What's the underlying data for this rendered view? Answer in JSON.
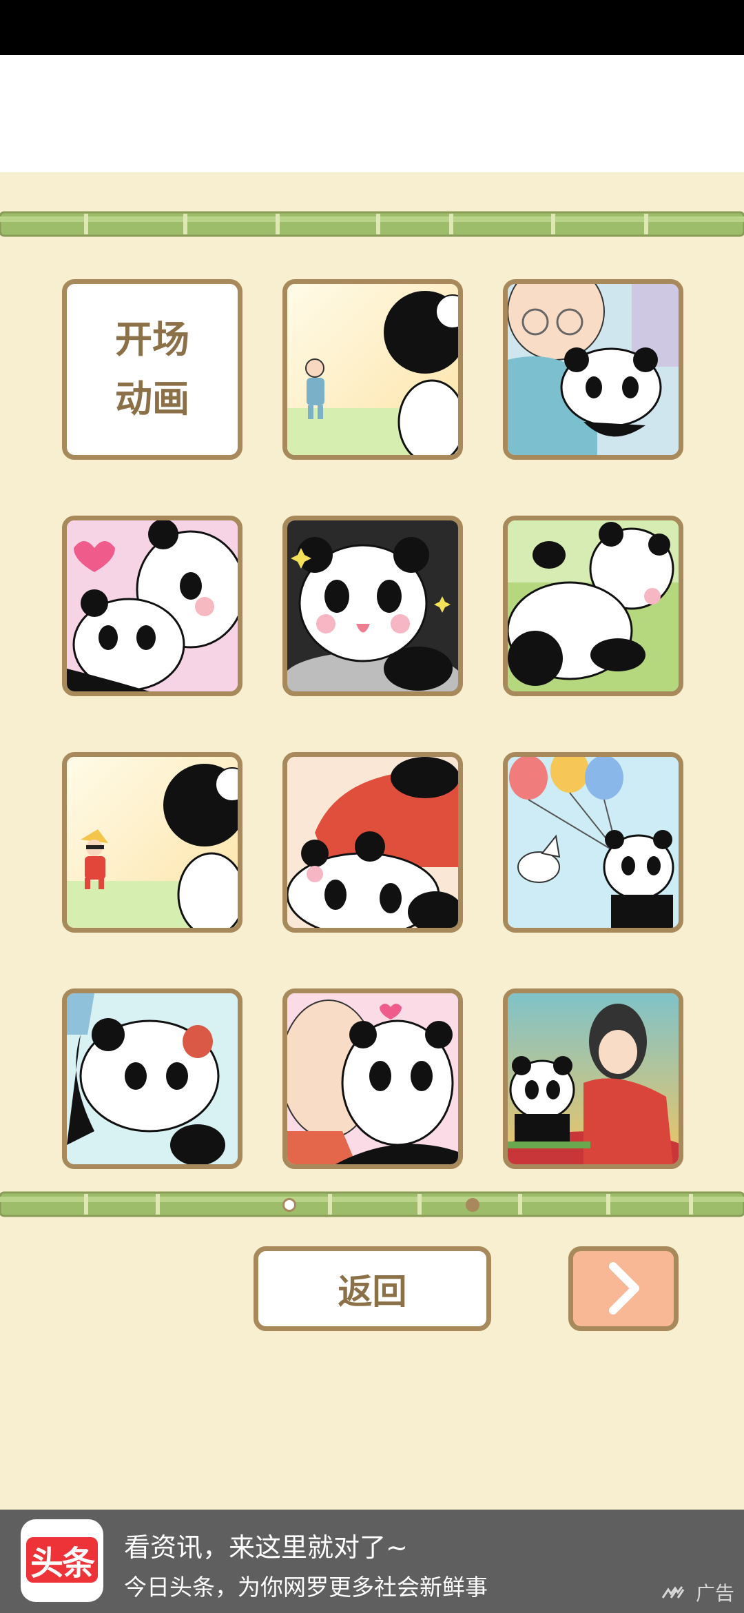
{
  "gallery": {
    "first_tile_label": [
      "开场",
      "动画"
    ],
    "tiles": [
      {
        "name": "tile-opening"
      },
      {
        "name": "tile-grandpa-meets-panda"
      },
      {
        "name": "tile-grandpa-hugs-panda"
      },
      {
        "name": "tile-pandas-heart"
      },
      {
        "name": "tile-panda-sparkle"
      },
      {
        "name": "tile-panda-lying-grass"
      },
      {
        "name": "tile-boy-meets-panda"
      },
      {
        "name": "tile-panda-red-jacket"
      },
      {
        "name": "tile-panda-balloons"
      },
      {
        "name": "tile-panda-crying"
      },
      {
        "name": "tile-baby-kiss-panda"
      },
      {
        "name": "tile-kimono-girl-panda"
      }
    ]
  },
  "pagination": {
    "current_page": 1,
    "total_pages": 2
  },
  "buttons": {
    "back_label": "返回",
    "next_icon": "chevron-right-icon"
  },
  "ad_banner": {
    "logo_text": "头条",
    "title": "看资讯，来这里就对了~",
    "subtitle": "今日头条，为你网罗更多社会新鲜事",
    "tag": "广告"
  },
  "colors": {
    "background": "#f7efcf",
    "tile_border": "#a7895b",
    "bamboo": "#9dbd6a",
    "next_button": "#f9b895",
    "ad_background": "#5f5f5f",
    "logo_red": "#ee3338"
  }
}
